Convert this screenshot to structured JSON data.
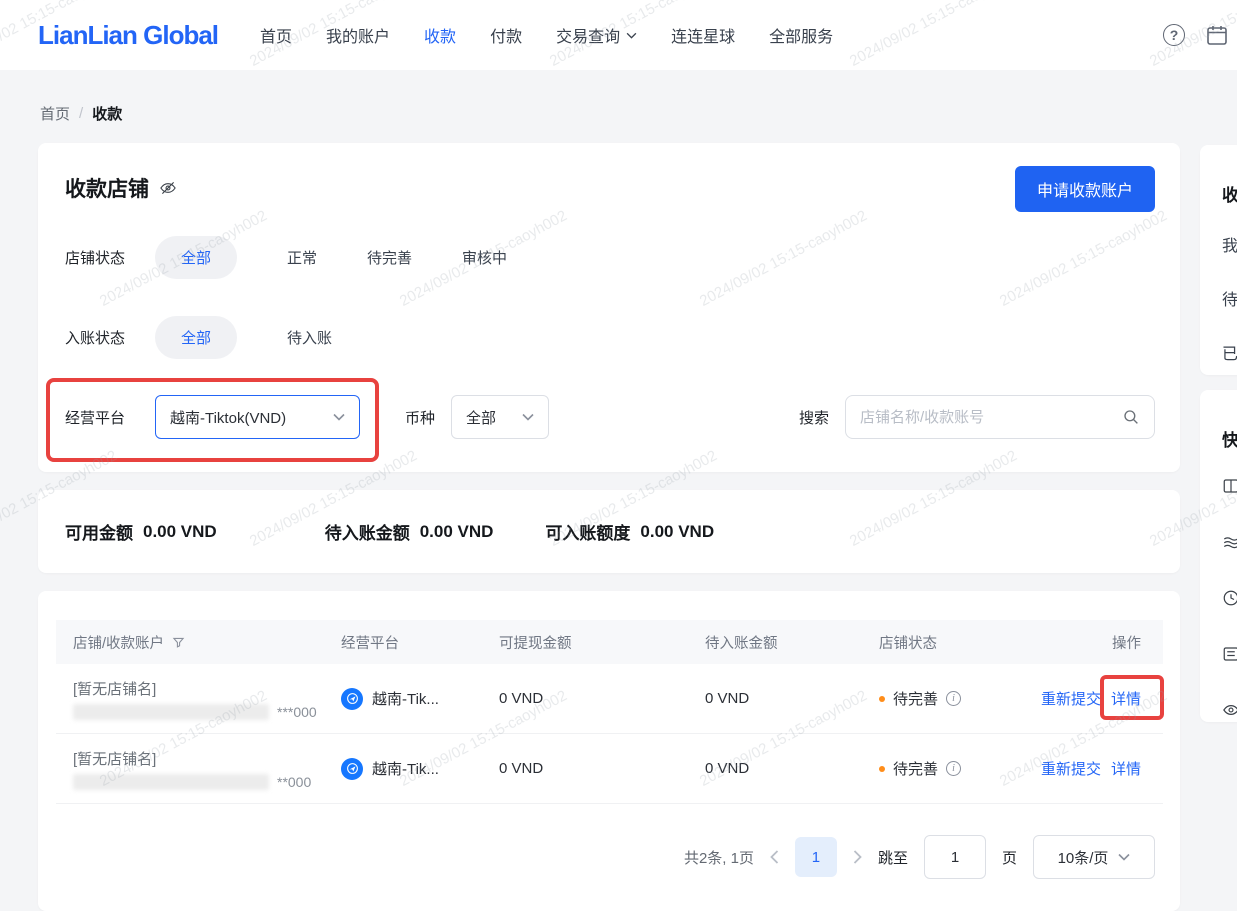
{
  "watermark": {
    "text": "2024/09/02 15:15-caoyh002"
  },
  "colors": {
    "accent_blue": "#2365f6",
    "annotation_red": "#e8423f",
    "status_orange": "#ff8d1a",
    "platform_icon_blue": "#1677ff",
    "selected_pill_bg": "#f0f1f4",
    "page_bg": "#f4f5f7"
  },
  "nav": {
    "logo": "LianLian Global",
    "items": [
      {
        "label": "首页",
        "active": false
      },
      {
        "label": "我的账户",
        "active": false
      },
      {
        "label": "收款",
        "active": true
      },
      {
        "label": "付款",
        "active": false
      },
      {
        "label": "交易查询",
        "active": false,
        "has_dropdown": true
      },
      {
        "label": "连连星球",
        "active": false
      },
      {
        "label": "全部服务",
        "active": false
      }
    ]
  },
  "breadcrumb": {
    "home": "首页",
    "separator": "/",
    "current": "收款"
  },
  "panel": {
    "title": "收款店铺",
    "apply_button": "申请收款账户",
    "filters": {
      "shop_status": {
        "label": "店铺状态",
        "options": [
          "全部",
          "正常",
          "待完善",
          "审核中"
        ],
        "selected": "全部"
      },
      "entry_status": {
        "label": "入账状态",
        "options": [
          "全部",
          "待入账"
        ],
        "selected": "全部"
      },
      "platform": {
        "label": "经营平台",
        "value": "越南-Tiktok(VND)"
      },
      "currency": {
        "label": "币种",
        "value": "全部"
      },
      "search": {
        "label": "搜索",
        "placeholder": "店铺名称/收款账号"
      }
    }
  },
  "summary": {
    "items": [
      {
        "label": "可用金额",
        "value": "0.00 VND"
      },
      {
        "label": "待入账金额",
        "value": "0.00 VND"
      },
      {
        "label": "可入账额度",
        "value": "0.00 VND"
      }
    ]
  },
  "table": {
    "columns": [
      "店铺/收款账户",
      "经营平台",
      "可提现金额",
      "待入账金额",
      "店铺状态",
      "操作"
    ],
    "rows": [
      {
        "shop_name": "[暂无店铺名]",
        "account_masked": "***000",
        "platform": "越南-Tik...",
        "withdrawable": "0 VND",
        "pending_amount": "0 VND",
        "status": "待完善",
        "action_resubmit": "重新提交",
        "action_detail": "详情",
        "detail_highlighted": true
      },
      {
        "shop_name": "[暂无店铺名]",
        "account_masked": "**000",
        "platform": "越南-Tik...",
        "withdrawable": "0 VND",
        "pending_amount": "0 VND",
        "status": "待完善",
        "action_resubmit": "重新提交",
        "action_detail": "详情",
        "detail_highlighted": false
      }
    ]
  },
  "pagination": {
    "total_text": "共2条, 1页",
    "current_page": "1",
    "jump_label": "跳至",
    "jump_value": "1",
    "page_unit": "页",
    "page_size_value": "10条/页"
  },
  "sidebar": {
    "top_card": {
      "title_partial": "收",
      "items_partial": [
        "我",
        "待",
        "已"
      ]
    },
    "quick_card": {
      "title_partial": "快",
      "icon_names": [
        "book-icon",
        "layers-icon",
        "clock-icon",
        "list-icon",
        "eye-icon"
      ]
    }
  }
}
